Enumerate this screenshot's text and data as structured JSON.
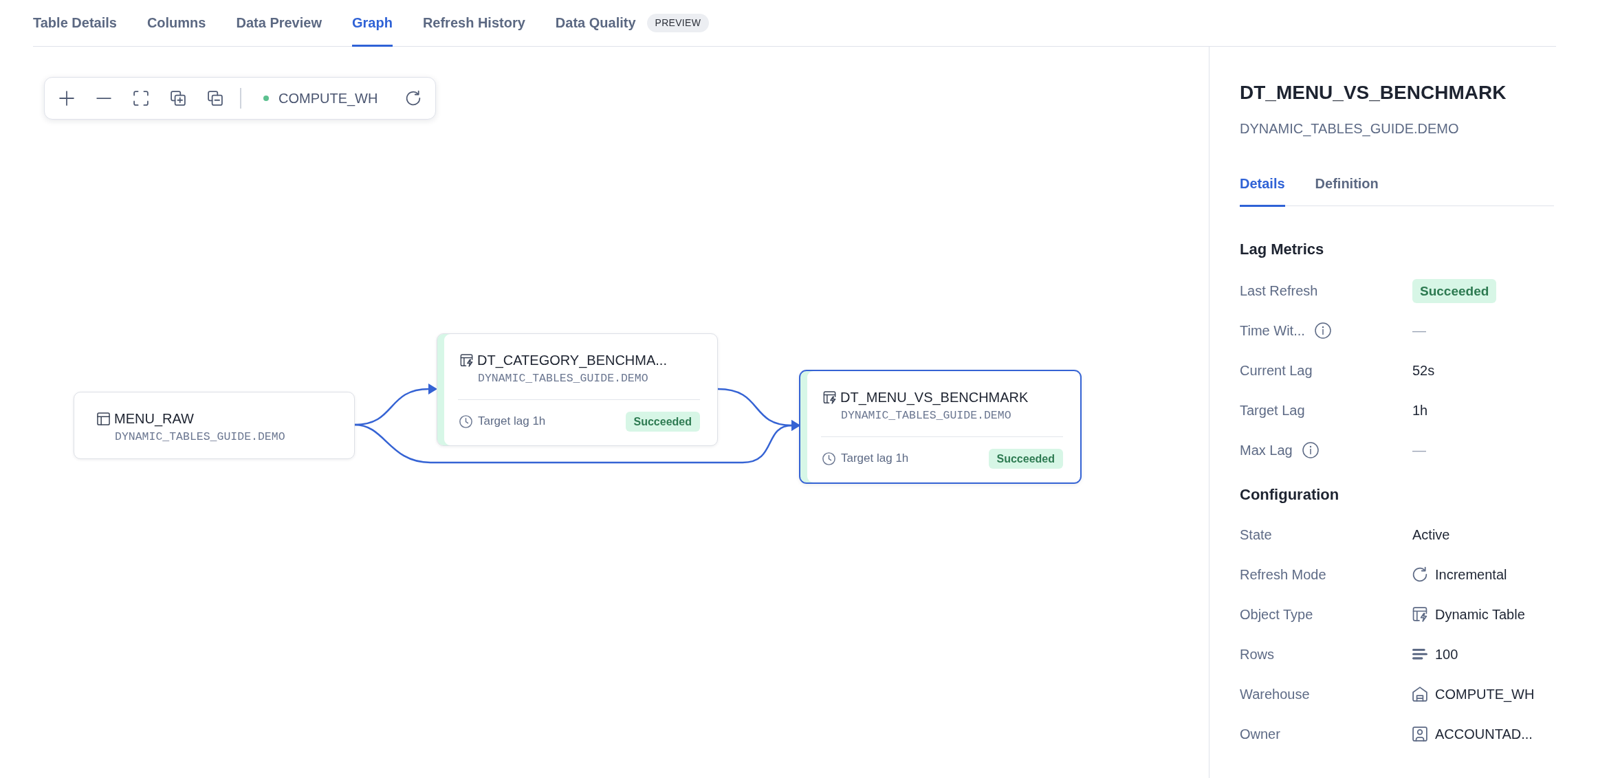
{
  "tabs": [
    {
      "label": "Table Details",
      "selected": false
    },
    {
      "label": "Columns",
      "selected": false
    },
    {
      "label": "Data Preview",
      "selected": false
    },
    {
      "label": "Graph",
      "selected": true
    },
    {
      "label": "Refresh History",
      "selected": false
    },
    {
      "label": "Data Quality",
      "selected": false,
      "badge": "PREVIEW"
    }
  ],
  "toolbar": {
    "warehouse": {
      "name": "COMPUTE_WH",
      "running": true
    }
  },
  "graph": {
    "nodes": [
      {
        "kind": "table",
        "name": "MENU_RAW",
        "schema": "DYNAMIC_TABLES_GUIDE.DEMO",
        "selected": false
      },
      {
        "kind": "dynamic",
        "name": "DT_CATEGORY_BENCHMA...",
        "schema": "DYNAMIC_TABLES_GUIDE.DEMO",
        "target_lag": "Target lag 1h",
        "status": "Succeeded",
        "selected": false
      },
      {
        "kind": "dynamic",
        "name": "DT_MENU_VS_BENCHMARK",
        "schema": "DYNAMIC_TABLES_GUIDE.DEMO",
        "target_lag": "Target lag 1h",
        "status": "Succeeded",
        "selected": true
      }
    ]
  },
  "details": {
    "title": "DT_MENU_VS_BENCHMARK",
    "subtitle": "DYNAMIC_TABLES_GUIDE.DEMO",
    "tabs": [
      {
        "label": "Details",
        "selected": true
      },
      {
        "label": "Definition",
        "selected": false
      }
    ],
    "sections": [
      {
        "heading": "Lag Metrics",
        "fields": [
          {
            "label": "Last Refresh",
            "kind": "badge",
            "value": "Succeeded",
            "info": false
          },
          {
            "label": "Time Wit...",
            "kind": "empty",
            "value": "—",
            "info": true
          },
          {
            "label": "Current Lag",
            "kind": "plain",
            "value": "52s",
            "info": false
          },
          {
            "label": "Target Lag",
            "kind": "plain",
            "value": "1h",
            "info": false
          },
          {
            "label": "Max Lag",
            "kind": "empty",
            "value": "—",
            "info": true
          }
        ]
      },
      {
        "heading": "Configuration",
        "fields": [
          {
            "label": "State",
            "kind": "plain",
            "value": "Active",
            "info": false
          },
          {
            "label": "Refresh Mode",
            "kind": "mode",
            "value": "Incremental",
            "info": false
          },
          {
            "label": "Object Type",
            "kind": "type",
            "value": "Dynamic Table",
            "info": false
          },
          {
            "label": "Rows",
            "kind": "count",
            "value": "100",
            "info": false
          },
          {
            "label": "Warehouse",
            "kind": "warehouse",
            "value": "COMPUTE_WH",
            "info": false
          },
          {
            "label": "Owner",
            "kind": "owner",
            "value": "ACCOUNTAD...",
            "info": false
          }
        ]
      }
    ]
  }
}
